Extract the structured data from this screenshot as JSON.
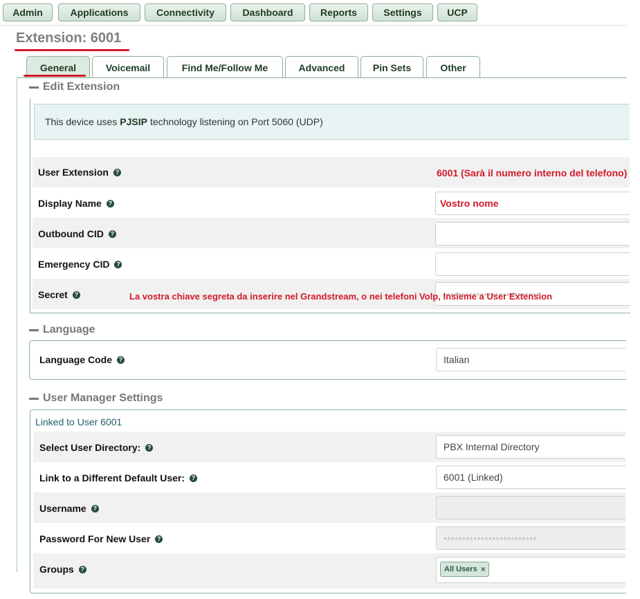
{
  "nav": {
    "admin": "Admin",
    "applications": "Applications",
    "connectivity": "Connectivity",
    "dashboard": "Dashboard",
    "reports": "Reports",
    "settings": "Settings",
    "ucp": "UCP"
  },
  "page": {
    "title": "Extension: 6001"
  },
  "tabs": {
    "general": "General",
    "voicemail": "Voicemail",
    "findme": "Find Me/Follow Me",
    "advanced": "Advanced",
    "pinsets": "Pin Sets",
    "other": "Other"
  },
  "edit_extension": {
    "heading": "Edit Extension",
    "info_before": "This device uses",
    "info_tech": "PJSIP",
    "info_after": "technology listening on Port 5060 (UDP)",
    "user_extension": {
      "label": "User Extension",
      "value": "6001 (Sarà il numero interno del telefono)"
    },
    "display_name": {
      "label": "Display Name",
      "value": "Vostro nome"
    },
    "outbound_cid": {
      "label": "Outbound CID",
      "value": ""
    },
    "emergency_cid": {
      "label": "Emergency CID",
      "value": ""
    },
    "secret": {
      "label": "Secret",
      "value": "••••••••••••••••••••••••••",
      "note": "La vostra chiave segreta da inserire nel Grandstream, o nei telefoni Volp, Insieme a User Extension"
    }
  },
  "language": {
    "heading": "Language",
    "code_label": "Language Code",
    "code_value": "Italian"
  },
  "user_manager": {
    "heading": "User Manager Settings",
    "linked_text": "Linked to User 6001",
    "directory": {
      "label": "Select User Directory:",
      "value": "PBX Internal Directory"
    },
    "default_user": {
      "label": "Link to a Different Default User:",
      "value": "6001 (Linked)"
    },
    "username": {
      "label": "Username",
      "value": ""
    },
    "password": {
      "label": "Password For New User",
      "value": "•••••••••••••••••••••••••"
    },
    "groups": {
      "label": "Groups",
      "chip": "All Users",
      "chip_remove": "×"
    }
  },
  "icons": {
    "help": "?",
    "collapse": "minus-icon"
  },
  "colors": {
    "accent_red": "#d11a2a",
    "nav_green": "#cfe1d4",
    "border_green": "#8fae99",
    "info_bg": "#e8f3f3"
  }
}
